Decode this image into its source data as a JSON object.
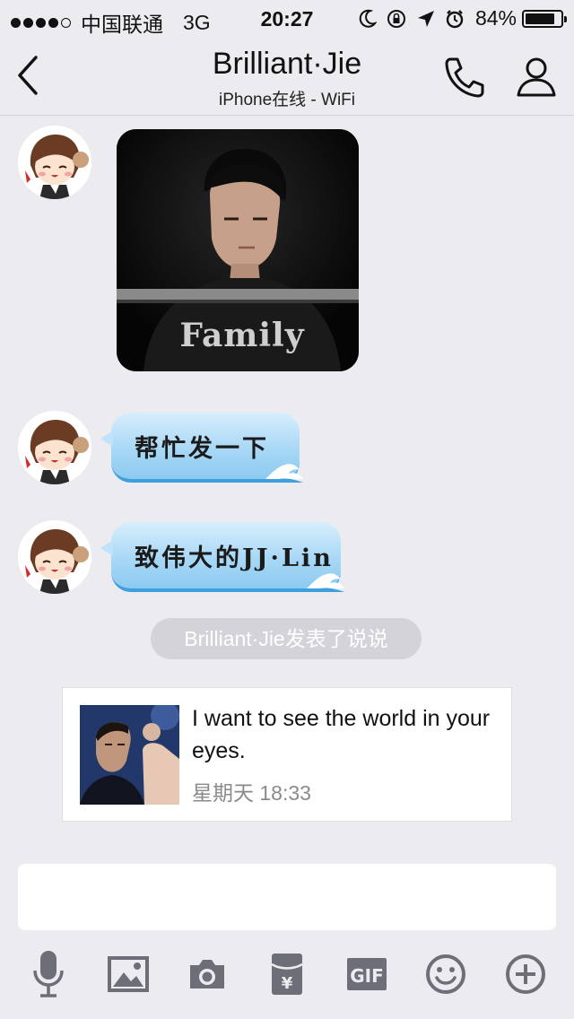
{
  "status_bar": {
    "carrier": "中国联通",
    "network": "3G",
    "time": "20:27",
    "battery": "84%",
    "battery_level": 0.84
  },
  "header": {
    "title": "Brilliant·Jie",
    "subtitle": "iPhone在线 - WiFi"
  },
  "messages": [
    {
      "type": "image"
    },
    {
      "type": "text",
      "text": "帮忙发一下"
    },
    {
      "type": "text",
      "text": "致伟大的JJ·Lin"
    }
  ],
  "system_notice": "Brilliant·Jie发表了说说",
  "share_card": {
    "text": "I want to see the world in your eyes.",
    "time": "星期天 18:33"
  },
  "input": {
    "value": "",
    "placeholder": ""
  },
  "toolbar": [
    {
      "name": "microphone-icon"
    },
    {
      "name": "image-icon"
    },
    {
      "name": "camera-icon"
    },
    {
      "name": "red-packet-icon"
    },
    {
      "name": "gif-icon",
      "label": "GIF"
    },
    {
      "name": "emoji-icon"
    },
    {
      "name": "plus-icon"
    }
  ],
  "colors": {
    "background": "#ebebf0",
    "bubble": "#a9d8f6",
    "bubble_edge": "#3f9fdc",
    "icon": "#6e6e78"
  }
}
